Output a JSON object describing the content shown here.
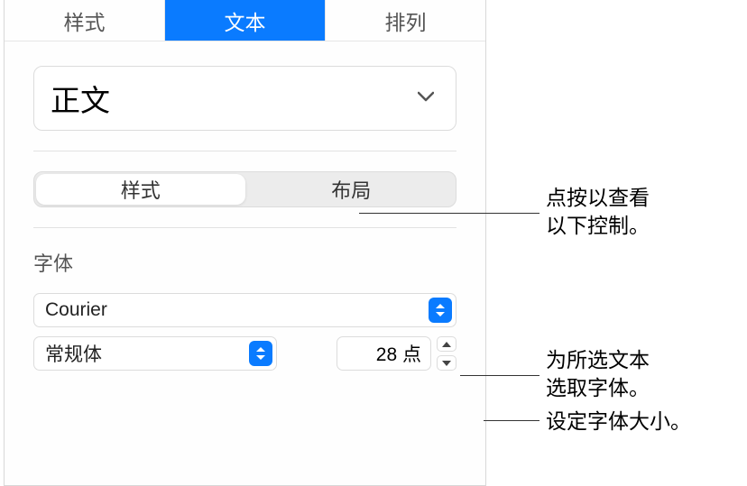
{
  "top_tabs": {
    "style": "样式",
    "text": "文本",
    "arrange": "排列",
    "active_index": 1
  },
  "paragraph_style": {
    "selected": "正文"
  },
  "inner_tabs": {
    "style": "样式",
    "layout": "布局",
    "active_index": 0
  },
  "font_section": {
    "label": "字体",
    "family": "Courier",
    "weight": "常规体",
    "size_value": "28 点"
  },
  "callouts": {
    "layout": "点按以查看\n以下控制。",
    "font_family": "为所选文本\n选取字体。",
    "font_size": "设定字体大小。"
  }
}
